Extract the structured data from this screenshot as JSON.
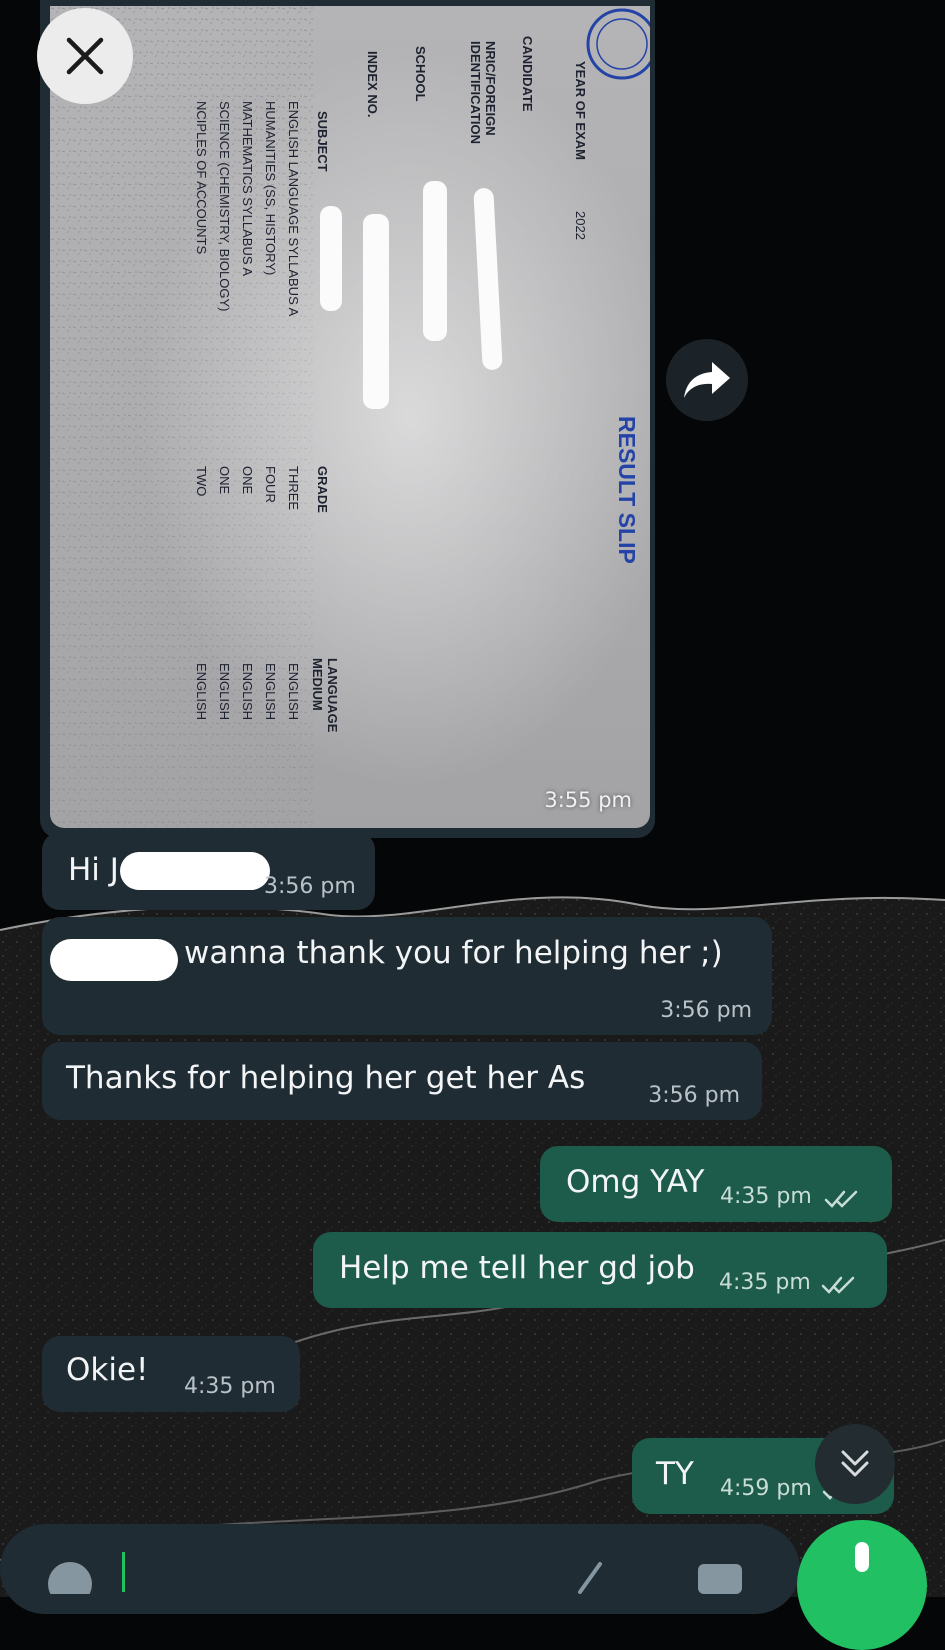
{
  "image_message": {
    "document": {
      "title": "RESULT SLIP",
      "year_label": "YEAR OF EXAM",
      "year_value": "2022",
      "candidate_label": "CANDIDATE",
      "nric_label": "NRIC/FOREIGN IDENTIFICATION",
      "school_label": "SCHOOL",
      "index_label": "INDEX NO.",
      "header_subject": "SUBJECT",
      "header_grade": "GRADE",
      "header_language": "LANGUAGE MEDIUM",
      "rows": [
        {
          "subject": "ENGLISH LANGUAGE SYLLABUS A",
          "grade": "THREE",
          "medium": "ENGLISH"
        },
        {
          "subject": "HUMANITIES (SS, HISTORY)",
          "grade": "FOUR",
          "medium": "ENGLISH"
        },
        {
          "subject": "MATHEMATICS SYLLABUS A",
          "grade": "ONE",
          "medium": "ENGLISH"
        },
        {
          "subject": "SCIENCE (CHEMISTRY, BIOLOGY)",
          "grade": "ONE",
          "medium": "ENGLISH"
        },
        {
          "subject": "NCIPLES OF ACCOUNTS",
          "grade": "TWO",
          "medium": "ENGLISH"
        }
      ]
    },
    "time": "3:55 pm"
  },
  "messages": [
    {
      "id": "m1",
      "direction": "in",
      "text": "Hi J",
      "time": "3:56 pm"
    },
    {
      "id": "m2",
      "direction": "in",
      "text": "wanna thank you for helping her ;)",
      "time": "3:56 pm"
    },
    {
      "id": "m3",
      "direction": "in",
      "text": "Thanks for helping her get her As",
      "time": "3:56 pm"
    },
    {
      "id": "m4",
      "direction": "out",
      "text": "Omg YAY",
      "time": "4:35 pm",
      "status": "read"
    },
    {
      "id": "m5",
      "direction": "out",
      "text": "Help me tell her gd job",
      "time": "4:35 pm",
      "status": "read"
    },
    {
      "id": "m6",
      "direction": "in",
      "text": "Okie!",
      "time": "4:35 pm"
    },
    {
      "id": "m7",
      "direction": "out",
      "text": "TY",
      "time": "4:59 pm",
      "status": "read"
    }
  ],
  "icons": {
    "close": "close-icon",
    "forward": "forward-icon",
    "scroll_down": "double-chevron-down-icon",
    "read_receipt": "double-check-icon"
  },
  "colors": {
    "incoming_bubble": "#1f2c34",
    "outgoing_bubble": "#1d5c4a",
    "background": "#050607",
    "mic_button": "#21c063",
    "document_title": "#2443a6"
  }
}
